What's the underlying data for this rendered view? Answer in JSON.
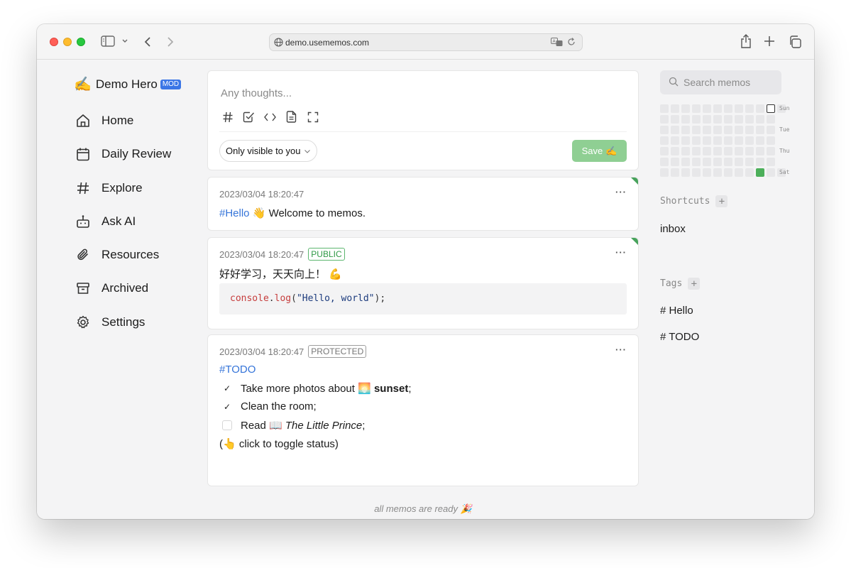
{
  "browser": {
    "url": "demo.usememos.com"
  },
  "user": {
    "emoji": "✍️",
    "name": "Demo Hero",
    "role_badge": "MOD"
  },
  "nav": {
    "items": [
      {
        "label": "Home",
        "icon": "home-icon"
      },
      {
        "label": "Daily Review",
        "icon": "calendar-icon"
      },
      {
        "label": "Explore",
        "icon": "hash-icon"
      },
      {
        "label": "Ask AI",
        "icon": "bot-icon"
      },
      {
        "label": "Resources",
        "icon": "paperclip-icon"
      },
      {
        "label": "Archived",
        "icon": "archive-icon"
      },
      {
        "label": "Settings",
        "icon": "gear-icon"
      }
    ]
  },
  "editor": {
    "placeholder": "Any thoughts...",
    "visibility": "Only visible to you",
    "save_label": "Save",
    "save_emoji": "✍️"
  },
  "memos": [
    {
      "date": "2023/03/04 18:20:47",
      "tag": "#Hello",
      "emoji": "👋",
      "text": "Welcome to memos."
    },
    {
      "date": "2023/03/04 18:20:47",
      "badge": "PUBLIC",
      "text": "好好学习，天天向上！",
      "emoji": "💪",
      "code": {
        "obj": "console",
        "dot": ".",
        "fn": "log",
        "open": "(",
        "str": "\"Hello, world\"",
        "close": ");"
      }
    },
    {
      "date": "2023/03/04 18:20:47",
      "badge": "PROTECTED",
      "tag": "#TODO",
      "tasks": [
        {
          "checked": true,
          "prefix": "Take more photos about",
          "emoji": "🌅",
          "strong": "sunset",
          "suffix": ";"
        },
        {
          "checked": true,
          "text": "Clean the room;"
        },
        {
          "checked": false,
          "prefix": "Read",
          "emoji": "📖",
          "italic": "The Little Prince",
          "suffix": ";"
        }
      ],
      "hint_open": "(",
      "hint_emoji": "👆",
      "hint_text": "click to toggle status)"
    }
  ],
  "footer_note": "all memos are ready",
  "footer_emoji": "🎉",
  "sidebar": {
    "search_placeholder": "Search memos",
    "heatmap_days": [
      "Sun",
      "Tue",
      "Thu",
      "Sat"
    ],
    "shortcuts_title": "Shortcuts",
    "shortcuts": [
      "inbox"
    ],
    "tags_title": "Tags",
    "tags": [
      "# Hello",
      "# TODO"
    ]
  },
  "colors": {
    "accent": "#3b76e6",
    "save_button": "#8fcf93",
    "public_badge": "#2e9945",
    "heatmap_active": "#4caf5a"
  }
}
